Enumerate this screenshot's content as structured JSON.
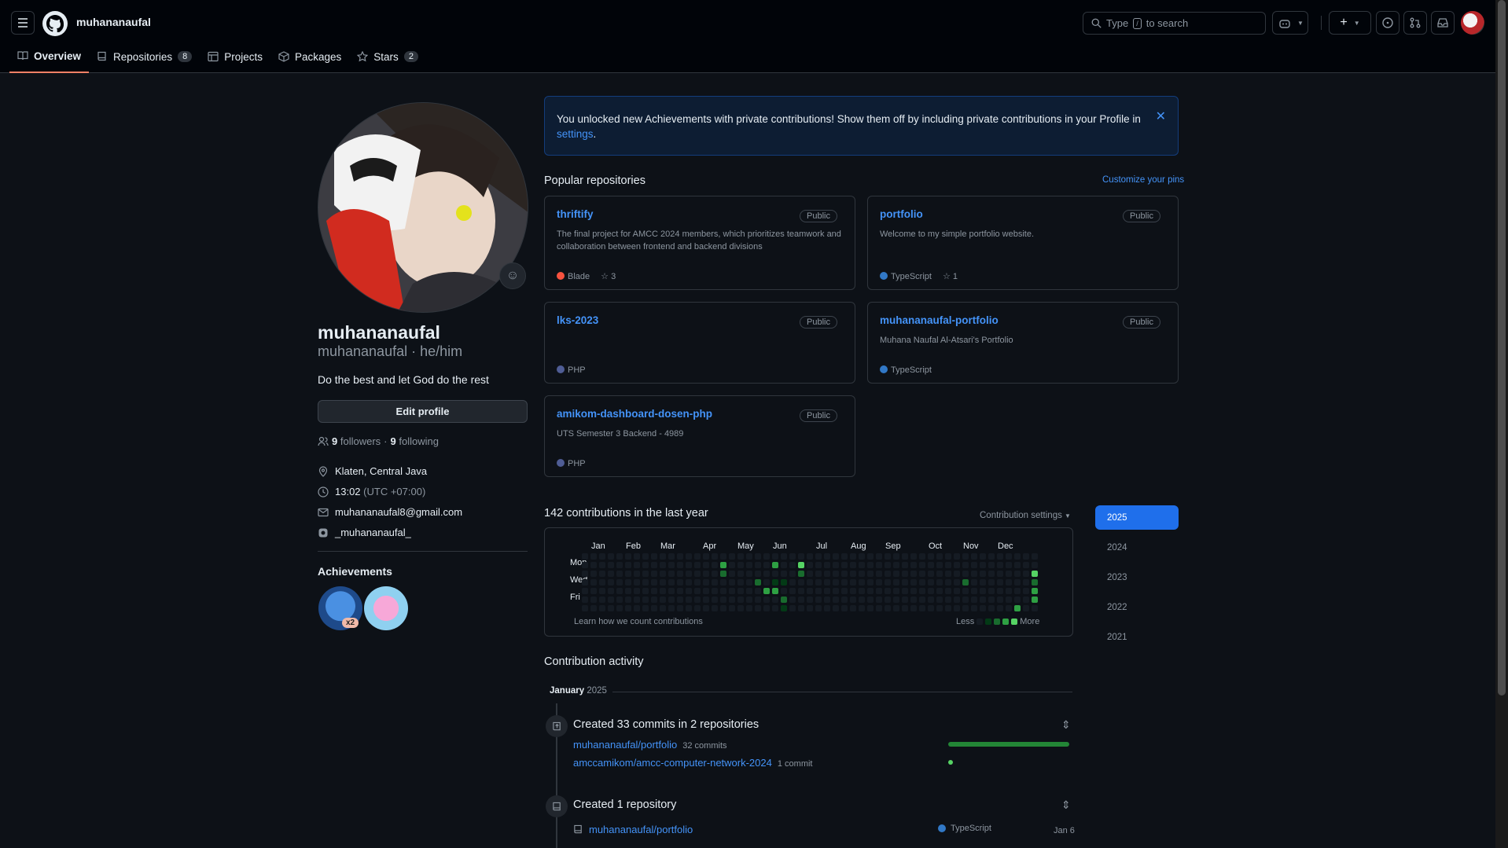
{
  "header": {
    "username": "muhananaufal",
    "search_placeholder_prefix": "Type",
    "search_key": "/",
    "search_placeholder_suffix": "to search"
  },
  "tabs": [
    {
      "label": "Overview",
      "count": null,
      "active": true
    },
    {
      "label": "Repositories",
      "count": "8",
      "active": false
    },
    {
      "label": "Projects",
      "count": null,
      "active": false
    },
    {
      "label": "Packages",
      "count": null,
      "active": false
    },
    {
      "label": "Stars",
      "count": "2",
      "active": false
    }
  ],
  "profile": {
    "name": "muhananaufal",
    "login_line": "muhananaufal · he/him",
    "bio": "Do the best and let God do the rest",
    "edit_button": "Edit profile",
    "followers_count": "9",
    "followers_label": "followers",
    "following_count": "9",
    "following_label": "following",
    "location": "Klaten, Central Java",
    "time": "13:02",
    "timezone": "(UTC +07:00)",
    "email": "muhananaufal8@gmail.com",
    "instagram": "_muhananaufal_",
    "achievements_title": "Achievements",
    "achievement_multiplier": "x2"
  },
  "flash": {
    "text": "You unlocked new Achievements with private contributions! Show them off by including private contributions in your Profile in",
    "link": "settings",
    "end": "."
  },
  "popular": {
    "title": "Popular repositories",
    "customize": "Customize your pins",
    "repos": [
      {
        "name": "thriftify",
        "visibility": "Public",
        "description": "The final project for AMCC 2024 members, which prioritizes teamwork and collaboration between frontend and backend divisions",
        "language": "Blade",
        "lang_color": "#f7523f",
        "stars": "3"
      },
      {
        "name": "portfolio",
        "visibility": "Public",
        "description": "Welcome to my simple portfolio website.",
        "language": "TypeScript",
        "lang_color": "#3178c6",
        "stars": "1"
      },
      {
        "name": "lks-2023",
        "visibility": "Public",
        "description": "",
        "language": "PHP",
        "lang_color": "#4F5D95",
        "stars": null
      },
      {
        "name": "muhananaufal-portfolio",
        "visibility": "Public",
        "description": "Muhana Naufal Al-Atsari's Portfolio",
        "language": "TypeScript",
        "lang_color": "#3178c6",
        "stars": null
      },
      {
        "name": "amikom-dashboard-dosen-php",
        "visibility": "Public",
        "description": "UTS Semester 3 Backend - 4989",
        "language": "PHP",
        "lang_color": "#4F5D95",
        "stars": null
      }
    ]
  },
  "contributions": {
    "title": "142 contributions in the last year",
    "settings": "Contribution settings",
    "months": [
      "Jan",
      "Feb",
      "Mar",
      "Apr",
      "May",
      "Jun",
      "Jul",
      "Aug",
      "Sep",
      "Oct",
      "Nov",
      "Dec"
    ],
    "days": [
      "Mon",
      "Wed",
      "Fri"
    ],
    "learn": "Learn how we count contributions",
    "less": "Less",
    "more": "More",
    "active_cells": [
      {
        "week": 16,
        "day": 1,
        "level": 3
      },
      {
        "week": 16,
        "day": 2,
        "level": 2
      },
      {
        "week": 20,
        "day": 3,
        "level": 2
      },
      {
        "week": 21,
        "day": 4,
        "level": 3
      },
      {
        "week": 22,
        "day": 1,
        "level": 3
      },
      {
        "week": 22,
        "day": 3,
        "level": 1
      },
      {
        "week": 22,
        "day": 4,
        "level": 3
      },
      {
        "week": 23,
        "day": 3,
        "level": 1
      },
      {
        "week": 23,
        "day": 5,
        "level": 2
      },
      {
        "week": 23,
        "day": 6,
        "level": 1
      },
      {
        "week": 24,
        "day": 7,
        "level": 4
      },
      {
        "week": 25,
        "day": 1,
        "level": 4
      },
      {
        "week": 25,
        "day": 2,
        "level": 2
      },
      {
        "week": 44,
        "day": 3,
        "level": 2
      },
      {
        "week": 50,
        "day": 6,
        "level": 3
      },
      {
        "week": 51,
        "day": 7,
        "level": 2
      },
      {
        "week": 52,
        "day": 2,
        "level": 4
      },
      {
        "week": 52,
        "day": 3,
        "level": 2
      },
      {
        "week": 52,
        "day": 4,
        "level": 3
      },
      {
        "week": 52,
        "day": 5,
        "level": 3
      }
    ],
    "level_colors": [
      "#151b23",
      "#033a16",
      "#196c2e",
      "#2ea043",
      "#56d364"
    ]
  },
  "years": [
    "2025",
    "2024",
    "2023",
    "2022",
    "2021"
  ],
  "activity": {
    "title": "Contribution activity",
    "month": "January",
    "year": "2025",
    "commits_title": "Created 33 commits in 2 repositories",
    "commit_repos": [
      {
        "name": "muhananaufal/portfolio",
        "count": "32 commits",
        "fraction": 1.0
      },
      {
        "name": "amccamikom/amcc-computer-network-2024",
        "count": "1 commit",
        "fraction": 0.03
      }
    ],
    "repo_title": "Created 1 repository",
    "created_repo": "muhananaufal/portfolio",
    "created_lang": "TypeScript",
    "created_date": "Jan 6"
  }
}
